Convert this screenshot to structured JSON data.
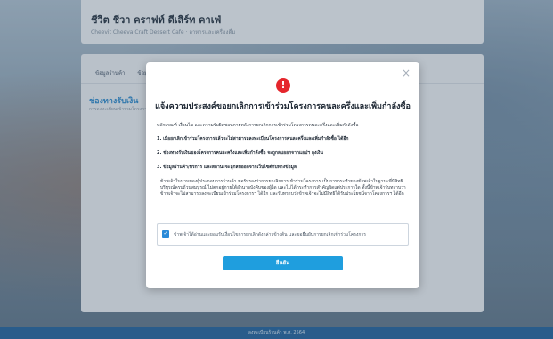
{
  "shop": {
    "name": "ชีวิต ชีวา คราฟท์ ดีเสิร์ท คาเฟ่",
    "subtitle": "Cheevit Cheeva Craft Dessert Cafe · อาหารและเครื่องดื่ม"
  },
  "tabs": [
    "ข้อมูลร้านค้า",
    "ข้อมูล"
  ],
  "section": {
    "title": "ช่องทางรับเงิน",
    "subtitle": "การลงทะเบียนเข้าร่วมโครงการ"
  },
  "footer": {
    "text": "ลงทะเบียนร้านค้า พ.ศ. 2564"
  },
  "modal": {
    "icon": "!",
    "close": "×",
    "title": "แจ้งความประสงค์ขอยกเลิกการเข้าร่วมโครงการคนละครึ่งและเพิ่มกำลังซื้อ",
    "intro": "หลักเกณฑ์ เงื่อนไข และความรับผิดชอบภายหลังการยกเลิกการเข้าร่วมโครงการคนละครึ่งและเพิ่มกำลังซื้อ",
    "rules": [
      "1. เมื่อยกเลิกเข้าร่วมโครงการแล้วจะไม่สามารถลงทะเบียนโครงการคนละครึ่งและเพิ่มกำลังซื้อ ได้อีก",
      "2. ช่องทางรับเงินของโครงการคนละครึ่งและเพิ่มกำลังซื้อ จะถูกลบออกจากแอปฯ ถุงเงิน",
      "3. ข้อมูลร้านค้า/บริการ และสถานะจะถูกลบออกจากเว็บไซต์กับทางข้อมูล"
    ],
    "paragraph": "ข้าพเจ้าในนามของผู้ประกอบการร้านค้า ขอรับรองว่าการยกเลิกการเข้าร่วมโครงการ เป็นการกระทำของข้าพเจ้าในฐานะที่มีสิทธิบริบูรณ์ครบถ้วนสมบูรณ์ ไม่ตกอยู่ภายใต้อำนาจบังคับของผู้ใด และไม่ได้กระทำการสำคัญผิดแต่ประการใด ทั้งนี้ข้าพเจ้ารับทราบว่า ข้าพเจ้าจะไม่สามารถลงทะเบียนเข้าร่วมโครงการฯ ได้อีก และรับทราบว่าข้าพเจ้าจะไม่มีสิทธิได้รับประโยชน์จากโครงการฯ ได้อีก",
    "checkbox_label": "ข้าพเจ้าได้อ่านและยอมรับเงื่อนไขการยกเลิกดังกล่าวข้างต้น และขอยืนยันการยกเลิกเข้าร่วมโครงการ",
    "checkbox_checked": true,
    "confirm_label": "ยืนยัน"
  },
  "colors": {
    "accent": "#1f9ede",
    "alert": "#e5262c",
    "section_title": "#2a86c9",
    "footer": "#1f5f9a"
  }
}
